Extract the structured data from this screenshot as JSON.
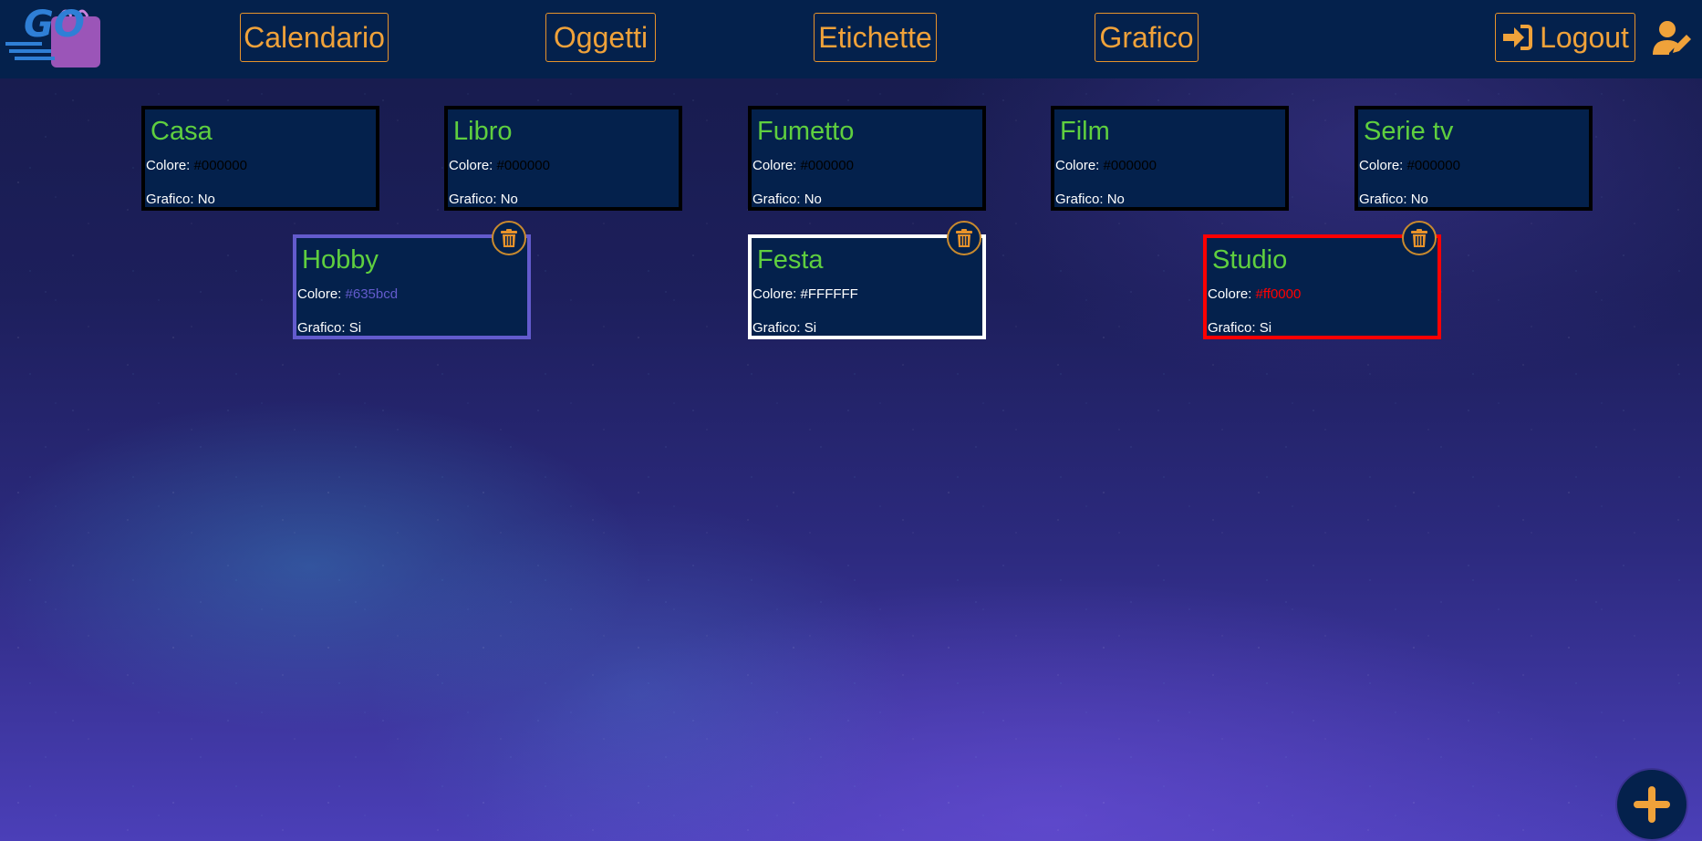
{
  "nav": {
    "calendar": "Calendario",
    "items": "Oggetti",
    "labels": "Etichette",
    "chart": "Grafico",
    "logout": "Logout"
  },
  "colors": {
    "header_bg": "#04214c",
    "accent_orange": "#f0a23a",
    "title_green": "#5fcf3f"
  },
  "labels": {
    "color_prefix": "Colore:",
    "chart_prefix": "Grafico:",
    "cards": [
      {
        "name": "Casa",
        "color": "#000000",
        "chart": "No"
      },
      {
        "name": "Libro",
        "color": "#000000",
        "chart": "No"
      },
      {
        "name": "Fumetto",
        "color": "#000000",
        "chart": "No"
      },
      {
        "name": "Film",
        "color": "#000000",
        "chart": "No"
      },
      {
        "name": "Serie tv",
        "color": "#000000",
        "chart": "No"
      },
      {
        "name": "Hobby",
        "color": "#635bcd",
        "chart": "Si"
      },
      {
        "name": "Festa",
        "color": "#FFFFFF",
        "chart": "Si"
      },
      {
        "name": "Studio",
        "color": "#ff0000",
        "chart": "Si"
      }
    ]
  },
  "icons": {
    "logo": "go-logo",
    "logout": "sign-in-icon",
    "profile": "user-edit-icon",
    "delete": "trash-icon",
    "add": "plus-icon"
  }
}
